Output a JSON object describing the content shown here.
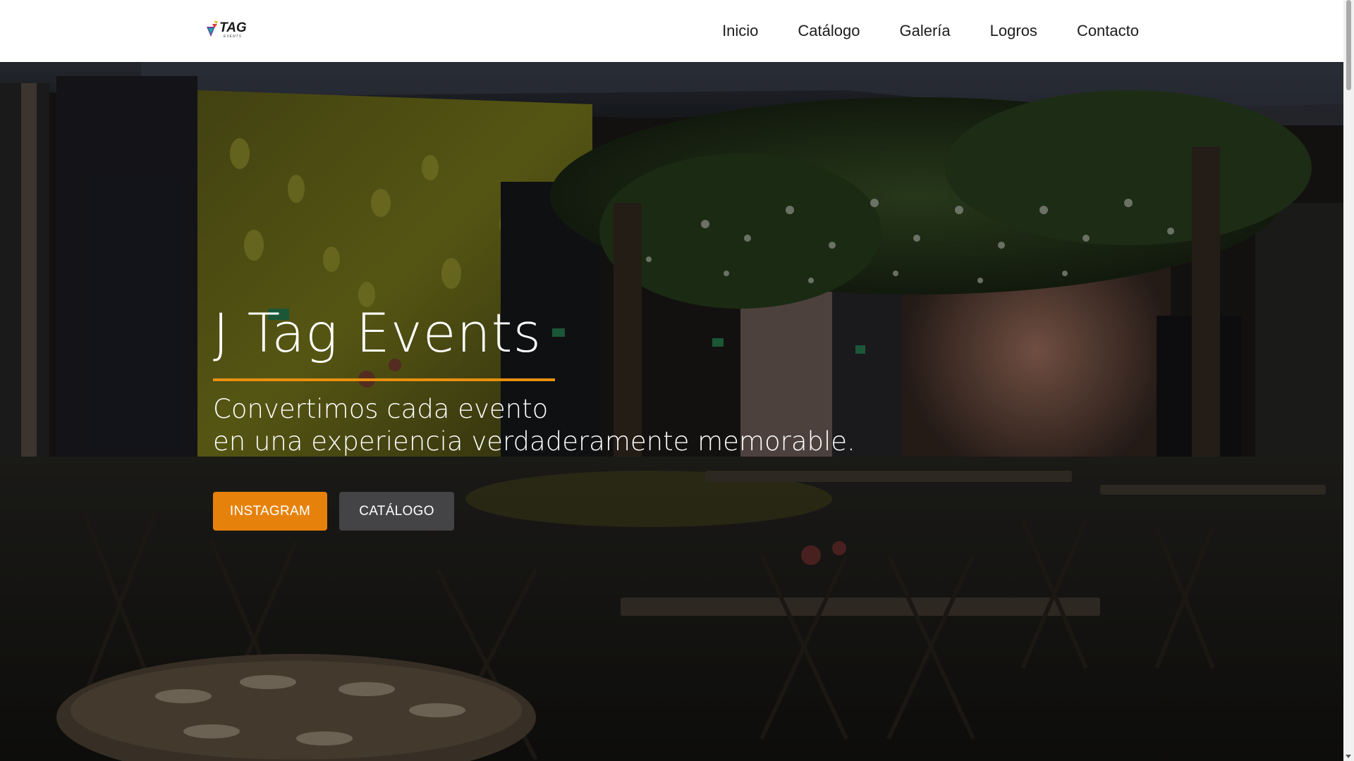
{
  "header": {
    "logo_text": "TAG",
    "logo_subtext": "EVENTS",
    "nav": [
      {
        "label": "Inicio"
      },
      {
        "label": "Catálogo"
      },
      {
        "label": "Galería"
      },
      {
        "label": "Logros"
      },
      {
        "label": "Contacto"
      }
    ]
  },
  "hero": {
    "title": "J Tag Events",
    "subtitle_line1": "Convertimos cada evento",
    "subtitle_line2": "en una experiencia verdaderamente memorable.",
    "buttons": {
      "instagram": "INSTAGRAM",
      "catalog": "CATÁLOGO"
    },
    "background": "event venue photo with decorated tables and greenery arch"
  },
  "colors": {
    "accent": "#e6820b",
    "underline": "#e8900f",
    "secondary_button": "#444446",
    "header_bg": "#ffffff",
    "nav_text": "#1c1c1c"
  },
  "icons": [
    "tag-logo-icon"
  ]
}
